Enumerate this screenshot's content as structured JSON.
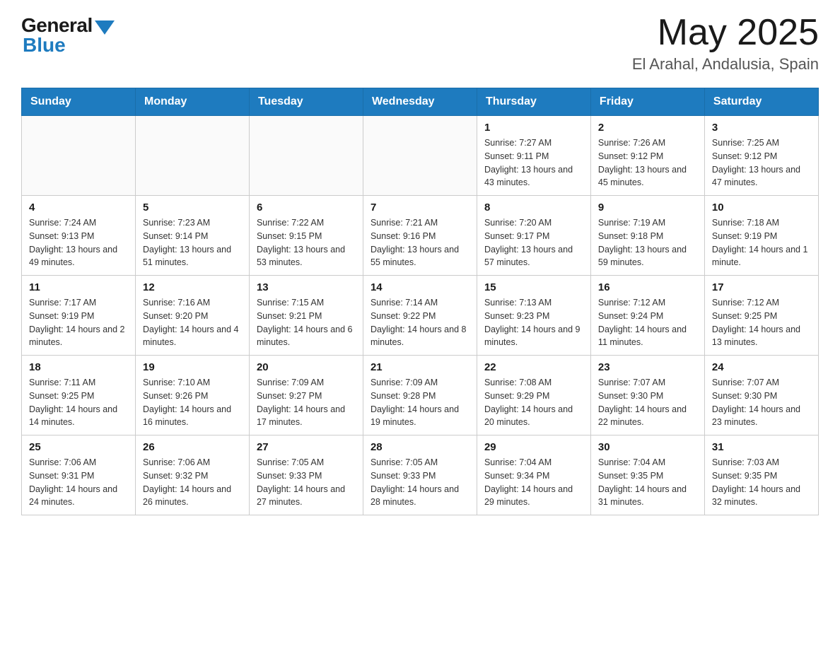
{
  "header": {
    "logo_general": "General",
    "logo_blue": "Blue",
    "month_year": "May 2025",
    "location": "El Arahal, Andalusia, Spain"
  },
  "days_of_week": [
    "Sunday",
    "Monday",
    "Tuesday",
    "Wednesday",
    "Thursday",
    "Friday",
    "Saturday"
  ],
  "weeks": [
    {
      "days": [
        {
          "num": "",
          "detail": ""
        },
        {
          "num": "",
          "detail": ""
        },
        {
          "num": "",
          "detail": ""
        },
        {
          "num": "",
          "detail": ""
        },
        {
          "num": "1",
          "detail": "Sunrise: 7:27 AM\nSunset: 9:11 PM\nDaylight: 13 hours\nand 43 minutes."
        },
        {
          "num": "2",
          "detail": "Sunrise: 7:26 AM\nSunset: 9:12 PM\nDaylight: 13 hours\nand 45 minutes."
        },
        {
          "num": "3",
          "detail": "Sunrise: 7:25 AM\nSunset: 9:12 PM\nDaylight: 13 hours\nand 47 minutes."
        }
      ]
    },
    {
      "days": [
        {
          "num": "4",
          "detail": "Sunrise: 7:24 AM\nSunset: 9:13 PM\nDaylight: 13 hours\nand 49 minutes."
        },
        {
          "num": "5",
          "detail": "Sunrise: 7:23 AM\nSunset: 9:14 PM\nDaylight: 13 hours\nand 51 minutes."
        },
        {
          "num": "6",
          "detail": "Sunrise: 7:22 AM\nSunset: 9:15 PM\nDaylight: 13 hours\nand 53 minutes."
        },
        {
          "num": "7",
          "detail": "Sunrise: 7:21 AM\nSunset: 9:16 PM\nDaylight: 13 hours\nand 55 minutes."
        },
        {
          "num": "8",
          "detail": "Sunrise: 7:20 AM\nSunset: 9:17 PM\nDaylight: 13 hours\nand 57 minutes."
        },
        {
          "num": "9",
          "detail": "Sunrise: 7:19 AM\nSunset: 9:18 PM\nDaylight: 13 hours\nand 59 minutes."
        },
        {
          "num": "10",
          "detail": "Sunrise: 7:18 AM\nSunset: 9:19 PM\nDaylight: 14 hours\nand 1 minute."
        }
      ]
    },
    {
      "days": [
        {
          "num": "11",
          "detail": "Sunrise: 7:17 AM\nSunset: 9:19 PM\nDaylight: 14 hours\nand 2 minutes."
        },
        {
          "num": "12",
          "detail": "Sunrise: 7:16 AM\nSunset: 9:20 PM\nDaylight: 14 hours\nand 4 minutes."
        },
        {
          "num": "13",
          "detail": "Sunrise: 7:15 AM\nSunset: 9:21 PM\nDaylight: 14 hours\nand 6 minutes."
        },
        {
          "num": "14",
          "detail": "Sunrise: 7:14 AM\nSunset: 9:22 PM\nDaylight: 14 hours\nand 8 minutes."
        },
        {
          "num": "15",
          "detail": "Sunrise: 7:13 AM\nSunset: 9:23 PM\nDaylight: 14 hours\nand 9 minutes."
        },
        {
          "num": "16",
          "detail": "Sunrise: 7:12 AM\nSunset: 9:24 PM\nDaylight: 14 hours\nand 11 minutes."
        },
        {
          "num": "17",
          "detail": "Sunrise: 7:12 AM\nSunset: 9:25 PM\nDaylight: 14 hours\nand 13 minutes."
        }
      ]
    },
    {
      "days": [
        {
          "num": "18",
          "detail": "Sunrise: 7:11 AM\nSunset: 9:25 PM\nDaylight: 14 hours\nand 14 minutes."
        },
        {
          "num": "19",
          "detail": "Sunrise: 7:10 AM\nSunset: 9:26 PM\nDaylight: 14 hours\nand 16 minutes."
        },
        {
          "num": "20",
          "detail": "Sunrise: 7:09 AM\nSunset: 9:27 PM\nDaylight: 14 hours\nand 17 minutes."
        },
        {
          "num": "21",
          "detail": "Sunrise: 7:09 AM\nSunset: 9:28 PM\nDaylight: 14 hours\nand 19 minutes."
        },
        {
          "num": "22",
          "detail": "Sunrise: 7:08 AM\nSunset: 9:29 PM\nDaylight: 14 hours\nand 20 minutes."
        },
        {
          "num": "23",
          "detail": "Sunrise: 7:07 AM\nSunset: 9:30 PM\nDaylight: 14 hours\nand 22 minutes."
        },
        {
          "num": "24",
          "detail": "Sunrise: 7:07 AM\nSunset: 9:30 PM\nDaylight: 14 hours\nand 23 minutes."
        }
      ]
    },
    {
      "days": [
        {
          "num": "25",
          "detail": "Sunrise: 7:06 AM\nSunset: 9:31 PM\nDaylight: 14 hours\nand 24 minutes."
        },
        {
          "num": "26",
          "detail": "Sunrise: 7:06 AM\nSunset: 9:32 PM\nDaylight: 14 hours\nand 26 minutes."
        },
        {
          "num": "27",
          "detail": "Sunrise: 7:05 AM\nSunset: 9:33 PM\nDaylight: 14 hours\nand 27 minutes."
        },
        {
          "num": "28",
          "detail": "Sunrise: 7:05 AM\nSunset: 9:33 PM\nDaylight: 14 hours\nand 28 minutes."
        },
        {
          "num": "29",
          "detail": "Sunrise: 7:04 AM\nSunset: 9:34 PM\nDaylight: 14 hours\nand 29 minutes."
        },
        {
          "num": "30",
          "detail": "Sunrise: 7:04 AM\nSunset: 9:35 PM\nDaylight: 14 hours\nand 31 minutes."
        },
        {
          "num": "31",
          "detail": "Sunrise: 7:03 AM\nSunset: 9:35 PM\nDaylight: 14 hours\nand 32 minutes."
        }
      ]
    }
  ]
}
